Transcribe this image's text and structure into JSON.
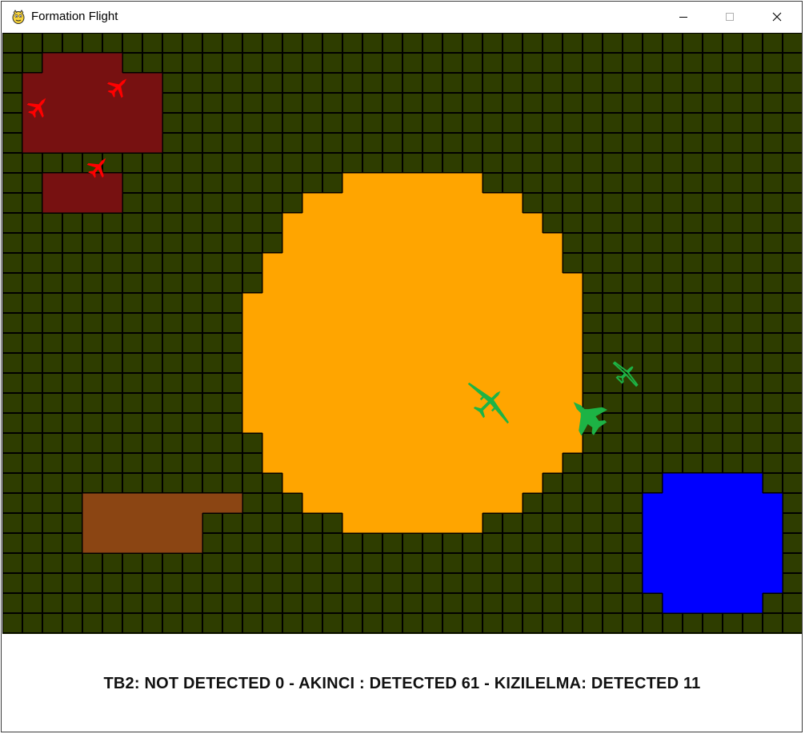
{
  "window": {
    "title": "Formation Flight",
    "minimize_glyph": "—",
    "maximize_glyph": "☐",
    "close_glyph": "✕"
  },
  "colors": {
    "grass": "#2e3d00",
    "grid_line": "#000000",
    "red_base": "#771111",
    "red_aircraft": "#ff0000",
    "lake": "#ffa500",
    "mud": "#8b4513",
    "blue_base": "#0000ff",
    "green_aircraft": "#1db345",
    "status_text": "#111111"
  },
  "grid": {
    "cols": 40,
    "rows": 30
  },
  "zones": [
    {
      "name": "red-base-zone",
      "fill": "#771111",
      "cells": [
        [
          2,
          1,
          5,
          1
        ],
        [
          1,
          2,
          7,
          5
        ],
        [
          2,
          7,
          5,
          8
        ]
      ]
    },
    {
      "name": "orange-lake-zone",
      "fill": "#ffa500",
      "cells": [
        [
          17,
          7,
          23,
          7
        ],
        [
          15,
          8,
          25,
          8
        ],
        [
          14,
          9,
          26,
          9
        ],
        [
          14,
          10,
          27,
          10
        ],
        [
          13,
          11,
          27,
          11
        ],
        [
          13,
          12,
          28,
          12
        ],
        [
          12,
          13,
          28,
          19
        ],
        [
          13,
          20,
          28,
          20
        ],
        [
          13,
          21,
          27,
          21
        ],
        [
          14,
          22,
          26,
          22
        ],
        [
          15,
          23,
          25,
          23
        ],
        [
          17,
          24,
          23,
          24
        ]
      ]
    },
    {
      "name": "brown-mud-zone",
      "fill": "#8b4513",
      "cells": [
        [
          4,
          23,
          11,
          23
        ],
        [
          4,
          24,
          9,
          25
        ]
      ]
    },
    {
      "name": "blue-base-zone",
      "fill": "#0000ff",
      "cells": [
        [
          33,
          22,
          37,
          22
        ],
        [
          32,
          23,
          38,
          27
        ],
        [
          33,
          28,
          37,
          28
        ]
      ]
    }
  ],
  "aircraft": [
    {
      "name": "red-aircraft-1",
      "icon": "fighter-jet-icon",
      "color": "#ff0000",
      "col": 5.8,
      "row": 2.7,
      "heading": 45,
      "scale": 0.9
    },
    {
      "name": "red-aircraft-2",
      "icon": "fighter-jet-icon",
      "color": "#ff0000",
      "col": 1.8,
      "row": 3.7,
      "heading": 40,
      "scale": 0.9
    },
    {
      "name": "red-aircraft-3",
      "icon": "fighter-jet-icon",
      "color": "#ff0000",
      "col": 4.8,
      "row": 6.7,
      "heading": 40,
      "scale": 0.9
    },
    {
      "name": "green-aircraft-akinci",
      "icon": "uav-drone-icon",
      "color": "#1db345",
      "col": 24.4,
      "row": 18.4,
      "heading": 45,
      "scale": 1.25
    },
    {
      "name": "green-aircraft-kizilelma",
      "icon": "jet-fighter-icon",
      "color": "#1db345",
      "col": 29.2,
      "row": 19.1,
      "heading": -45,
      "scale": 1.15
    },
    {
      "name": "green-aircraft-tb2",
      "icon": "small-uav-icon",
      "color": "#1db345",
      "col": 31.2,
      "row": 17.0,
      "heading": 45,
      "scale": 0.9
    }
  ],
  "status": {
    "text": "TB2: NOT DETECTED 0 - AKINCI : DETECTED 61 - KIZILELMA: DETECTED 11"
  }
}
